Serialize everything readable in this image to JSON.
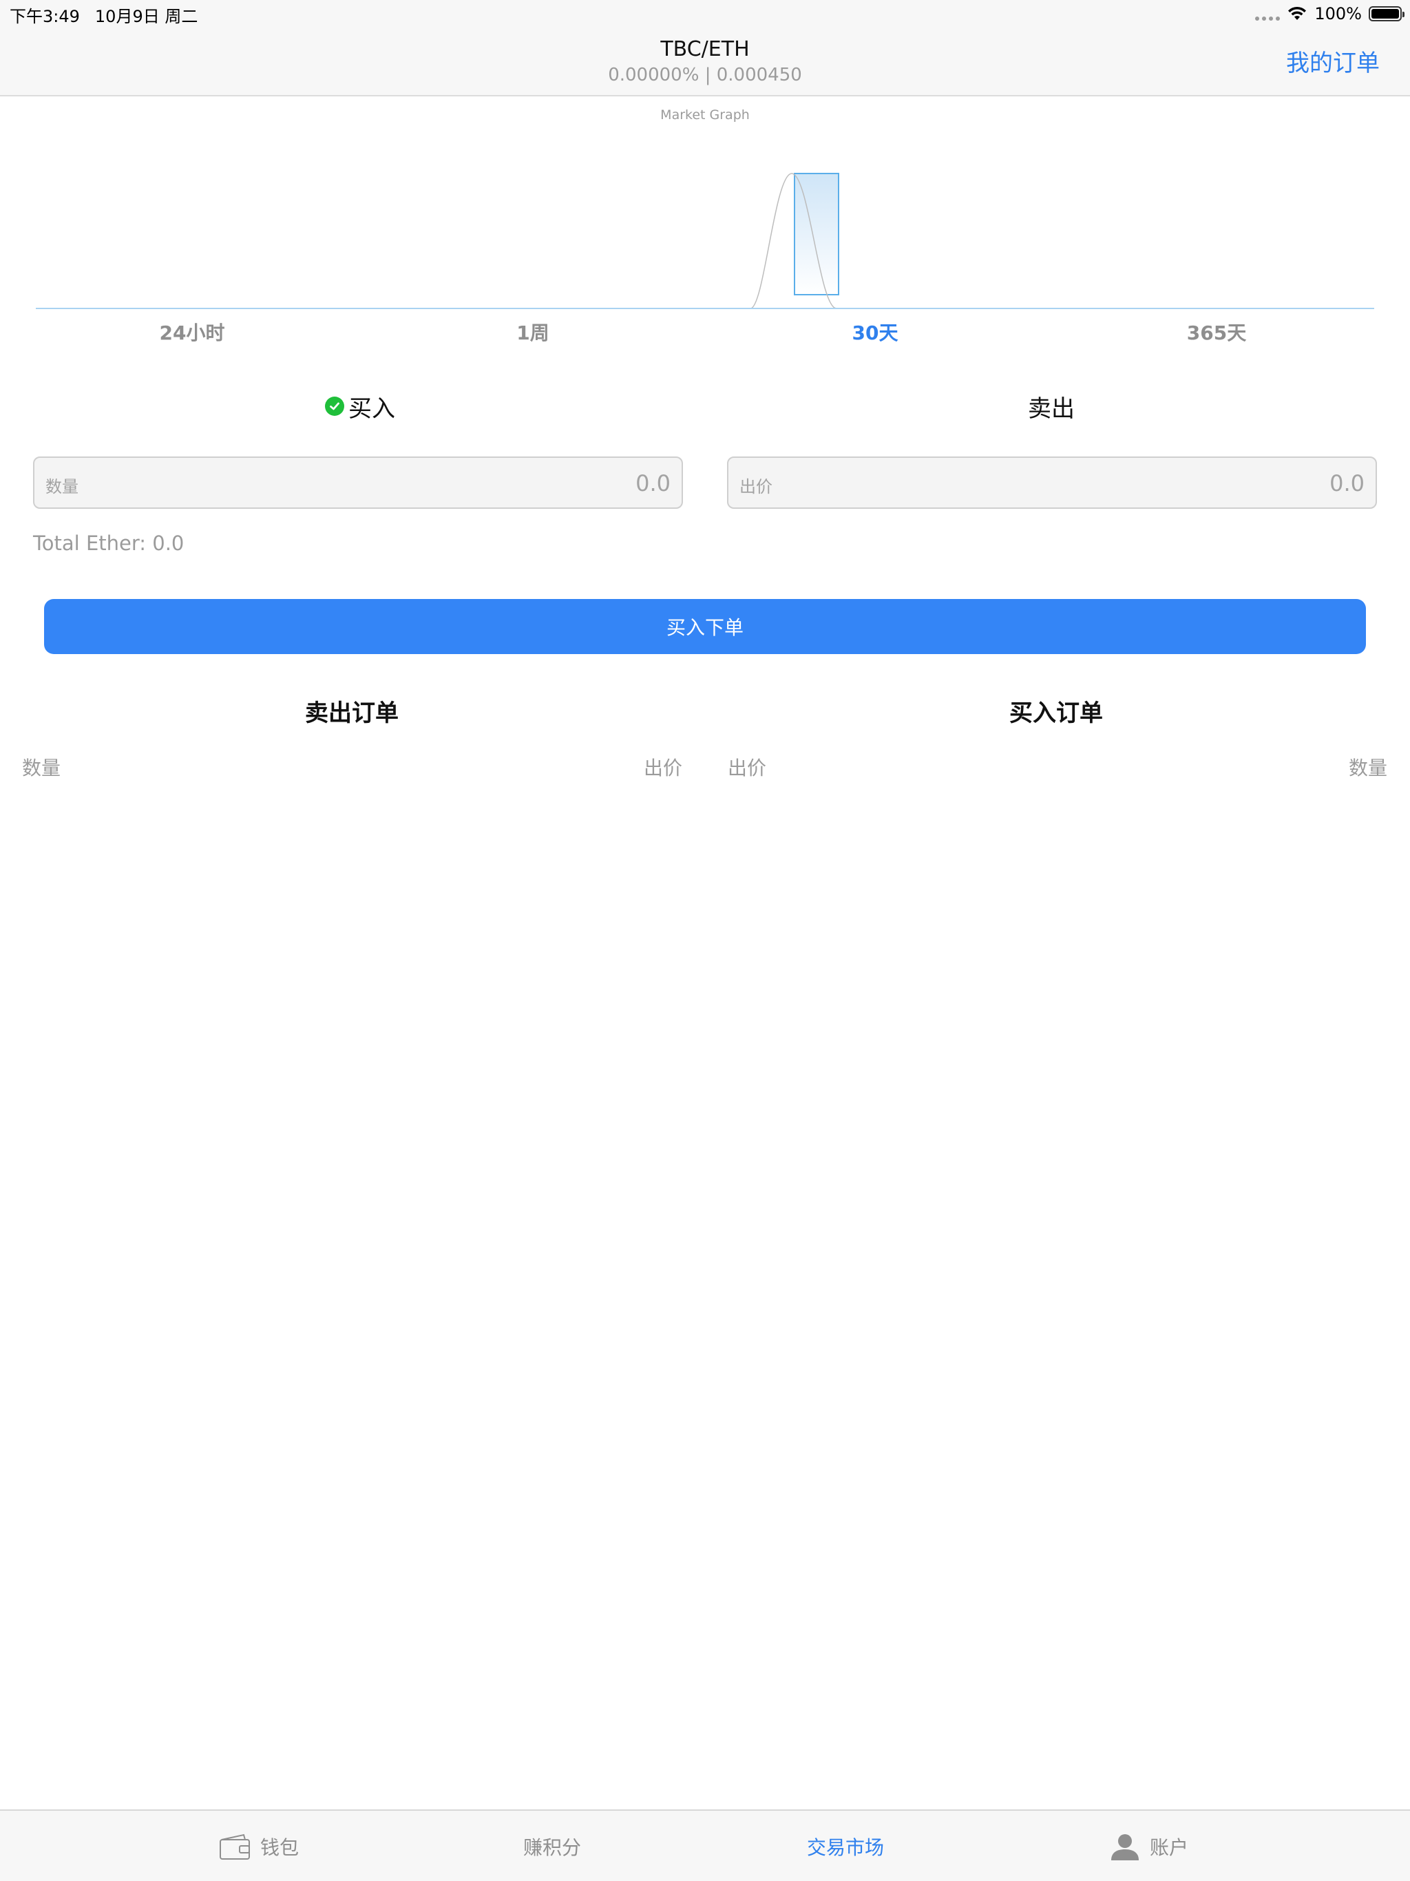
{
  "status_bar": {
    "time": "下午3:49",
    "date": "10月9日 周二",
    "battery": "100%"
  },
  "nav": {
    "title": "TBC/ETH",
    "subtitle": "0.00000% | 0.000450",
    "action": "我的订单"
  },
  "chart": {
    "caption": "Market Graph",
    "accent": "#5aaee9"
  },
  "range_tabs": [
    {
      "label": "24小时",
      "active": false
    },
    {
      "label": "1周",
      "active": false
    },
    {
      "label": "30天",
      "active": true
    },
    {
      "label": "365天",
      "active": false
    }
  ],
  "segment": {
    "buy_label": "买入",
    "sell_label": "卖出",
    "selected": "buy"
  },
  "form": {
    "quantity_label": "数量",
    "quantity_placeholder": "0.0",
    "price_label": "出价",
    "price_placeholder": "0.0",
    "total": "Total Ether: 0.0",
    "submit": "买入下单"
  },
  "sell_orders": {
    "title": "卖出订单",
    "col_quantity": "数量",
    "col_price": "出价",
    "rows": []
  },
  "buy_orders": {
    "title": "买入订单",
    "col_price": "出价",
    "col_quantity": "数量",
    "rows": []
  },
  "tab_bar": {
    "items": [
      {
        "label": "钱包",
        "icon": "wallet-icon",
        "active": false
      },
      {
        "label": "赚积分",
        "icon": "",
        "active": false
      },
      {
        "label": "交易市场",
        "icon": "",
        "active": true
      },
      {
        "label": "账户",
        "icon": "person-icon",
        "active": false
      }
    ]
  },
  "colors": {
    "accent": "#2f80ed",
    "button": "#3485f6",
    "check": "#1fbf3a"
  }
}
